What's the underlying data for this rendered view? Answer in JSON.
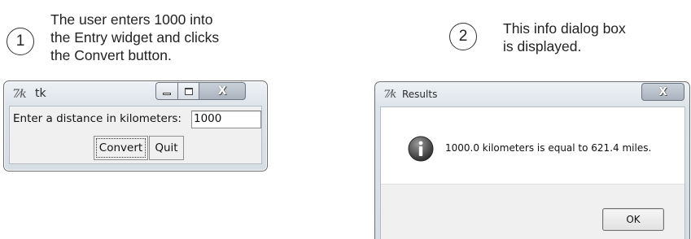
{
  "annotations": {
    "step1": {
      "number": "1",
      "lines": [
        "The user enters 1000 into",
        "the Entry widget and clicks",
        "the Convert button."
      ]
    },
    "step2": {
      "number": "2",
      "lines": [
        "This info dialog box",
        "is displayed."
      ]
    }
  },
  "tk_window": {
    "title": "tk",
    "title_icon": "tk-feather-icon",
    "buttons": [
      "minimize",
      "maximize",
      "close"
    ],
    "label": "Enter a distance in kilometers:",
    "entry_value": "1000",
    "convert_label": "Convert",
    "quit_label": "Quit"
  },
  "results_dialog": {
    "title": "Results",
    "title_icon": "tk-feather-icon",
    "icon": "info-icon",
    "message": "1000.0 kilometers is equal to 621.4 miles.",
    "ok_label": "OK"
  }
}
